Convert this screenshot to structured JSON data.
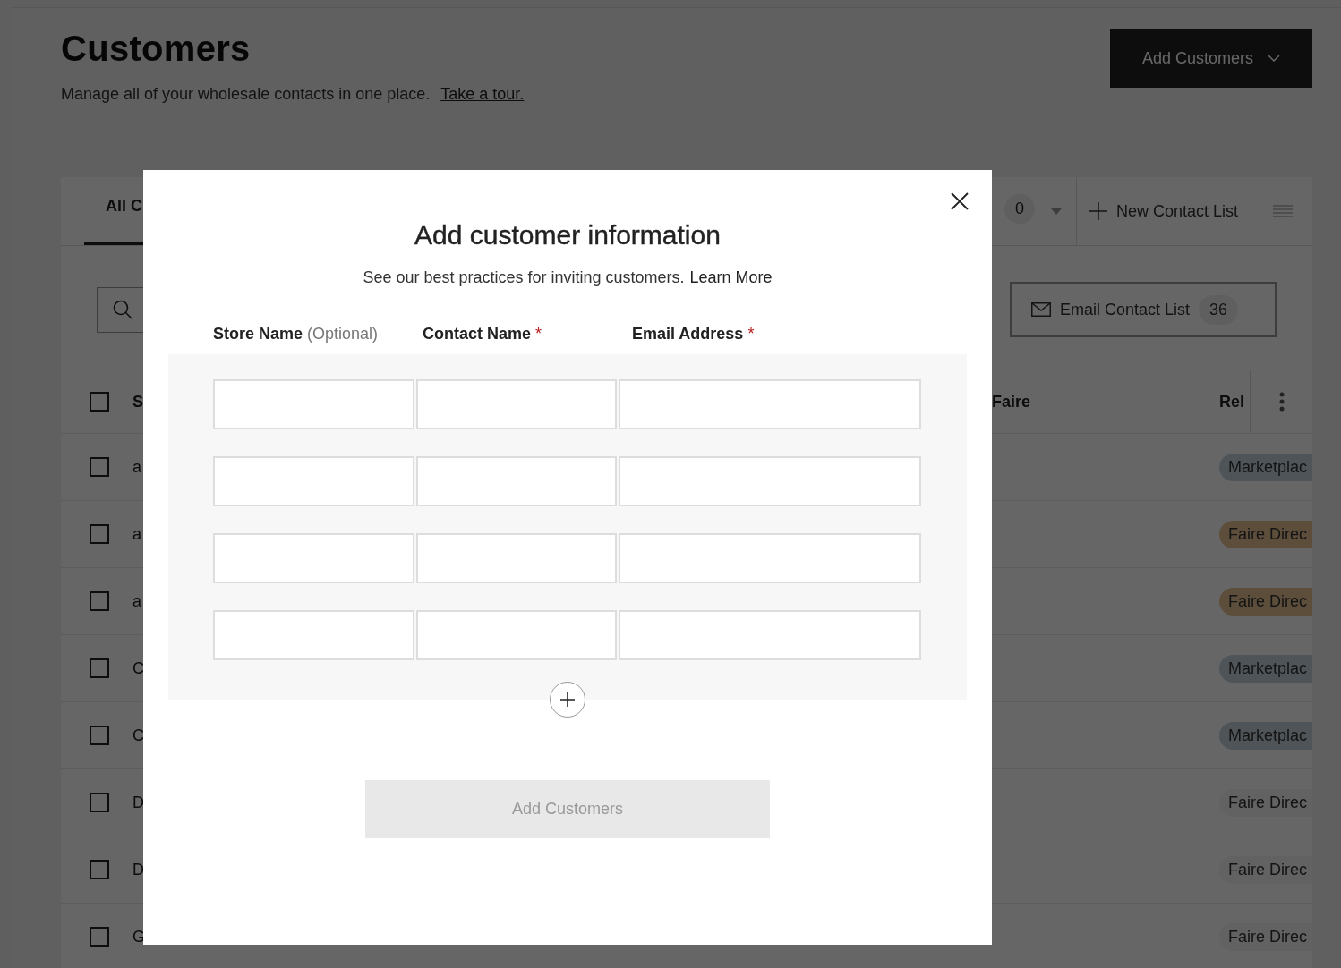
{
  "page": {
    "title": "Customers",
    "subtitle": "Manage all of your wholesale contacts in one place.",
    "tour_link": "Take a tour.",
    "add_button": "Add Customers"
  },
  "tabs": [
    {
      "label": "All C",
      "selected": true
    }
  ],
  "tab_count": "0",
  "new_list_button": "New Contact List",
  "email_button": {
    "label": "Email Contact List",
    "count": "36"
  },
  "table": {
    "all_checked": false,
    "columns": [
      "S",
      "Faire",
      "Rel"
    ],
    "rows": [
      {
        "column_1": "a",
        "checked": false,
        "tag": {
          "label": "Marketplac",
          "color": "#4e5458"
        }
      },
      {
        "column_1": "a",
        "checked": false,
        "tag": {
          "label": "Faire Direc",
          "color": "#5c4e3a"
        }
      },
      {
        "column_1": "a",
        "checked": false,
        "tag": {
          "label": "Faire Direc",
          "color": "#5c4e3a"
        }
      },
      {
        "column_1": "C",
        "checked": false,
        "tag": {
          "label": "Marketplac",
          "color": "#4e5458"
        }
      },
      {
        "column_1": "C",
        "checked": false,
        "tag": {
          "label": "Marketplac",
          "color": "#4e5458"
        }
      },
      {
        "column_1": "D",
        "checked": false,
        "tag": {
          "label": "Faire Direc",
          "color": "#626262"
        }
      },
      {
        "column_1": "D",
        "checked": false,
        "tag": {
          "label": "Faire Direc",
          "color": "#626262"
        }
      },
      {
        "column_1": "G",
        "checked": false,
        "tag": {
          "label": "Faire Direc",
          "color": "#626262"
        }
      }
    ]
  },
  "modal": {
    "title": "Add customer information",
    "subtitle": "See our best practices for inviting customers.",
    "link": "Learn More",
    "fields": [
      {
        "label": "Store Name",
        "note": "(Optional)"
      },
      {
        "label": "Contact Name",
        "marker": "*"
      },
      {
        "label": "Email Address",
        "marker": "*"
      }
    ],
    "input_rows": [
      {
        "kind": "entry"
      },
      {
        "kind": "entry"
      },
      {
        "kind": "entry"
      },
      {
        "kind": "entry"
      }
    ],
    "submit": {
      "label": "Add Customers",
      "disabled": true
    }
  }
}
